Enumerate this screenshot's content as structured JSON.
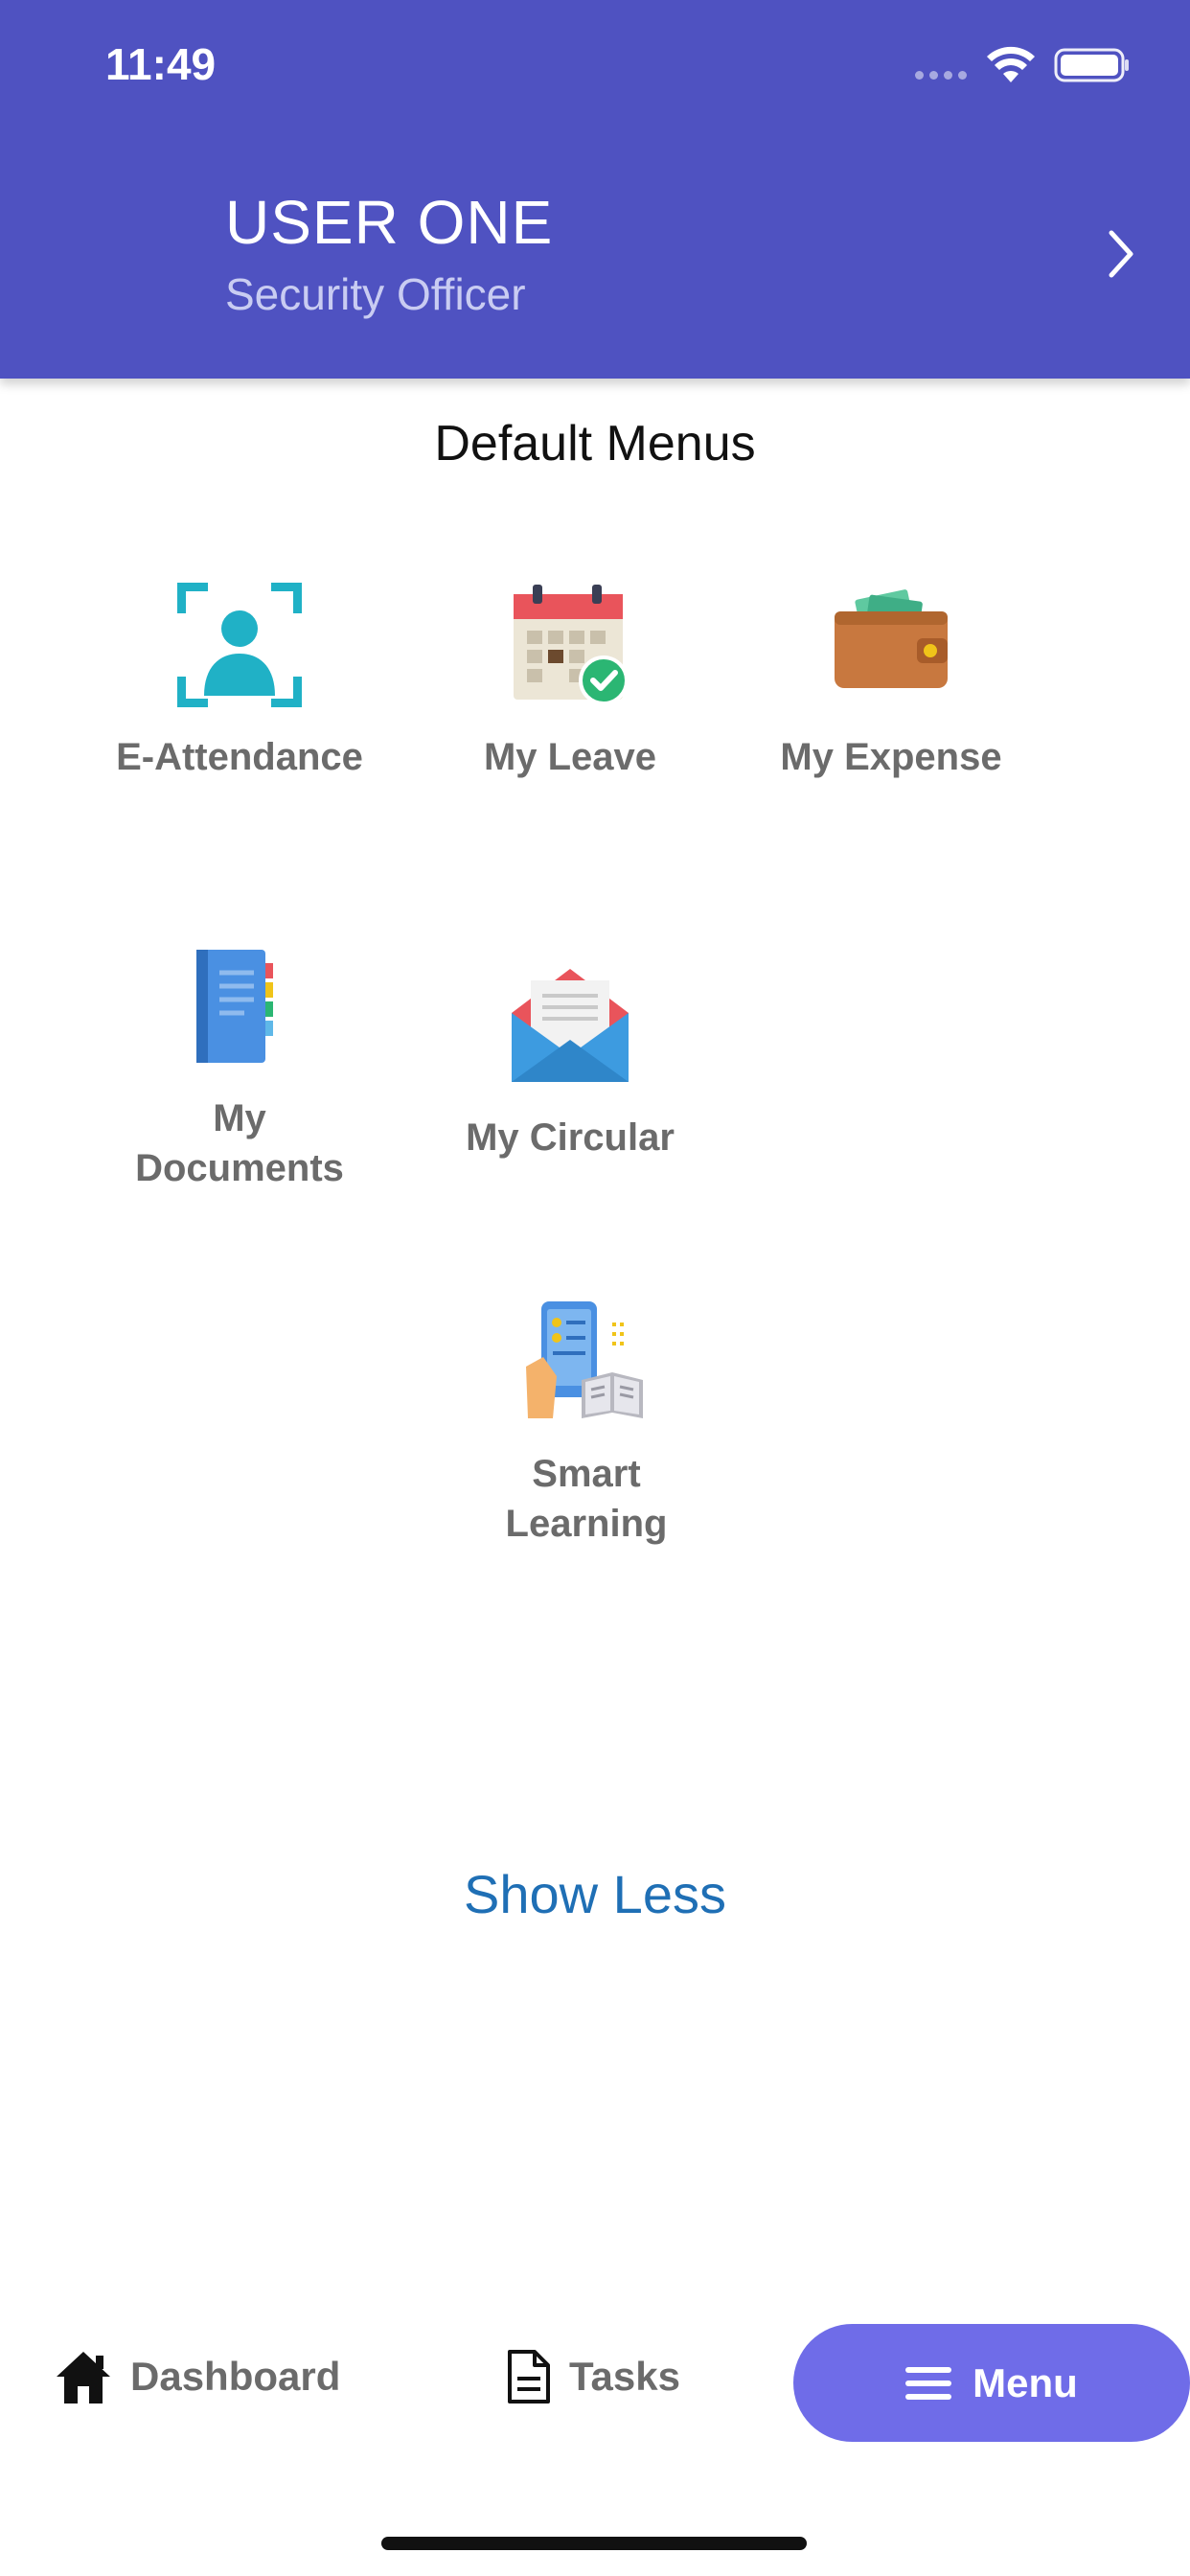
{
  "status_bar": {
    "time": "11:49"
  },
  "profile": {
    "name": "USER ONE",
    "role": "Security Officer"
  },
  "section": {
    "title": "Default Menus"
  },
  "menus": [
    {
      "label": "E-Attendance",
      "icon": "face-scan-icon"
    },
    {
      "label": "My Leave",
      "icon": "calendar-check-icon"
    },
    {
      "label": "My Expense",
      "icon": "wallet-icon"
    },
    {
      "label": "My\nDocuments",
      "icon": "notebook-icon"
    },
    {
      "label": "My Circular",
      "icon": "envelope-icon"
    },
    {
      "label": "Smart\nLearning",
      "icon": "mobile-learning-icon"
    }
  ],
  "show_less": "Show Less",
  "bottom_nav": {
    "dashboard": "Dashboard",
    "tasks": "Tasks",
    "menu": "Menu"
  },
  "colors": {
    "header": "#4F52C1",
    "menu_button": "#6F6CE8",
    "link": "#1F6FB5"
  }
}
